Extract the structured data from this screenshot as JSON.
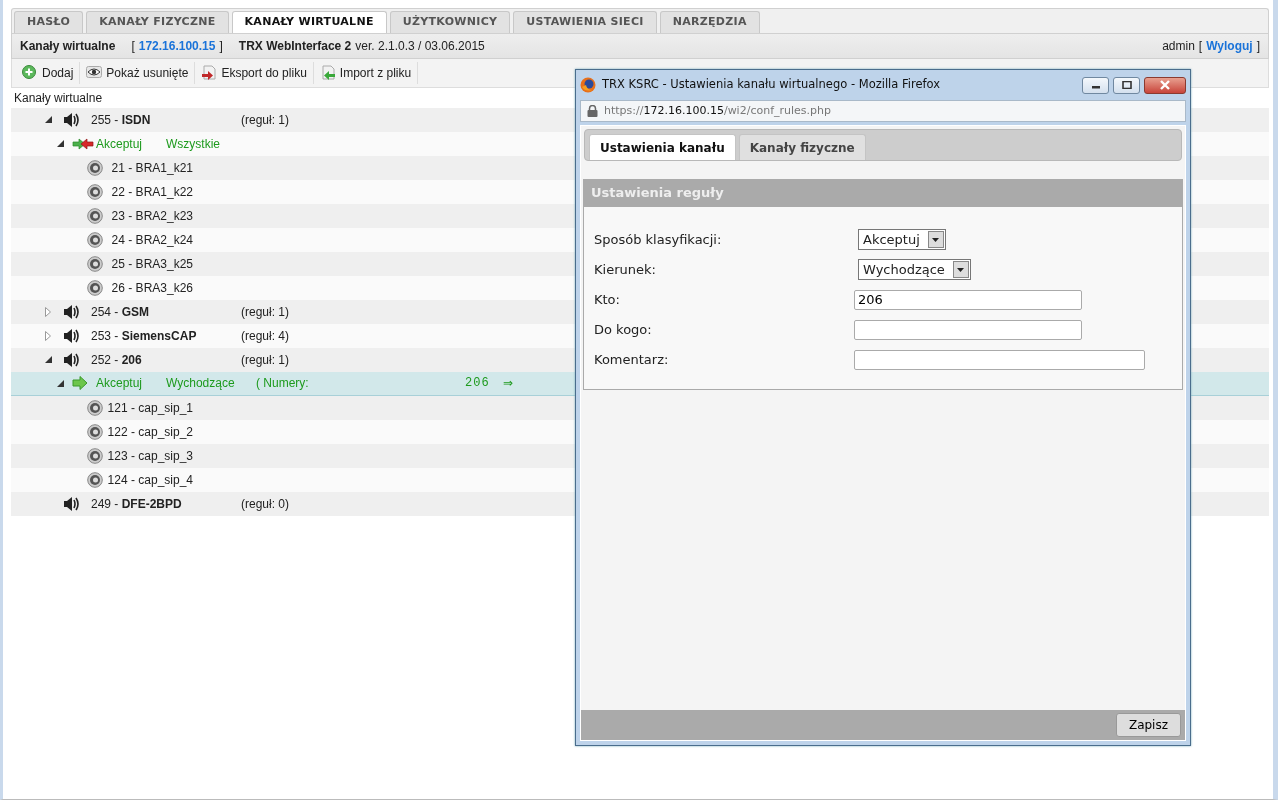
{
  "tabs": [
    {
      "label": "HASŁO",
      "selected": false
    },
    {
      "label": "KANAŁY FIZYCZNE",
      "selected": false
    },
    {
      "label": "KANAŁY WIRTUALNE",
      "selected": true
    },
    {
      "label": "UŻYTKOWNICY",
      "selected": false
    },
    {
      "label": "USTAWIENIA SIECI",
      "selected": false
    },
    {
      "label": "NARZĘDZIA",
      "selected": false
    }
  ],
  "header": {
    "title": "Kanały wirtualne",
    "ip_open": "[",
    "ip": "172.16.100.15",
    "ip_close": "]",
    "product": "TRX WebInterface 2",
    "version": "ver. 2.1.0.3 / 03.06.2015",
    "user": "admin",
    "logout_open": "[",
    "logout": "Wyloguj",
    "logout_close": "]"
  },
  "toolbar": [
    {
      "label": "Dodaj",
      "kind": "add"
    },
    {
      "label": "Pokaż usunięte",
      "kind": "view"
    },
    {
      "label": "Eksport do pliku",
      "kind": "export"
    },
    {
      "label": "Import z pliku",
      "kind": "import"
    }
  ],
  "tree_title": "Kanały wirtualne",
  "channels": [
    {
      "label": "255 - **ISDN**",
      "rules": "(reguł: 1)",
      "expanded": true,
      "children": [
        {
          "kind": "both",
          "action": "Akceptuj",
          "direction": "Wszystkie",
          "expanded": true,
          "selected": false,
          "children": [
            {
              "label": "21 - BRA1_k21"
            },
            {
              "label": "22 - BRA1_k22"
            },
            {
              "label": "23 - BRA2_k23"
            },
            {
              "label": "24 - BRA2_k24"
            },
            {
              "label": "25 - BRA3_k25"
            },
            {
              "label": "26 - BRA3_k26"
            }
          ]
        }
      ]
    },
    {
      "label": "254 - **GSM**",
      "rules": "(reguł: 1)",
      "expanded": false
    },
    {
      "label": "253 - **SiemensCAP**",
      "rules": "(reguł: 4)",
      "expanded": false
    },
    {
      "label": "252 - **206**",
      "rules": "(reguł: 1)",
      "expanded": true,
      "children": [
        {
          "kind": "out",
          "action": "Akceptuj",
          "direction": "Wychodzące",
          "numbers_label": "( Numery:",
          "numbers": "206",
          "arrow": "⇒",
          "expanded": true,
          "selected": true,
          "children": [
            {
              "label": "121 - cap_sip_1"
            },
            {
              "label": "122 - cap_sip_2"
            },
            {
              "label": "123 - cap_sip_3"
            },
            {
              "label": "124 - cap_sip_4"
            }
          ]
        }
      ]
    },
    {
      "label": "249 - **DFE-2BPD**",
      "rules": "(reguł: 0)"
    }
  ],
  "popup": {
    "title": "TRX KSRC - Ustawienia kanału wirtualnego - Mozilla Firefox",
    "url": {
      "scheme": "https://",
      "host": "172.16.100.15",
      "path": "/wi2/conf_rules.php"
    },
    "tabs": [
      {
        "label": "Ustawienia kanału",
        "selected": true
      },
      {
        "label": "Kanały fizyczne",
        "selected": false
      }
    ],
    "section": "Ustawienia reguły",
    "fields": [
      {
        "label": "Sposób klasyfikacji:",
        "kind": "select",
        "value": "Akceptuj"
      },
      {
        "label": "Kierunek:",
        "kind": "select",
        "value": "Wychodzące"
      },
      {
        "label": "Kto:",
        "kind": "text",
        "value": "206"
      },
      {
        "label": "Do kogo:",
        "kind": "text"
      },
      {
        "label": "Komentarz:",
        "kind": "wide"
      }
    ],
    "save": "Zapisz"
  }
}
